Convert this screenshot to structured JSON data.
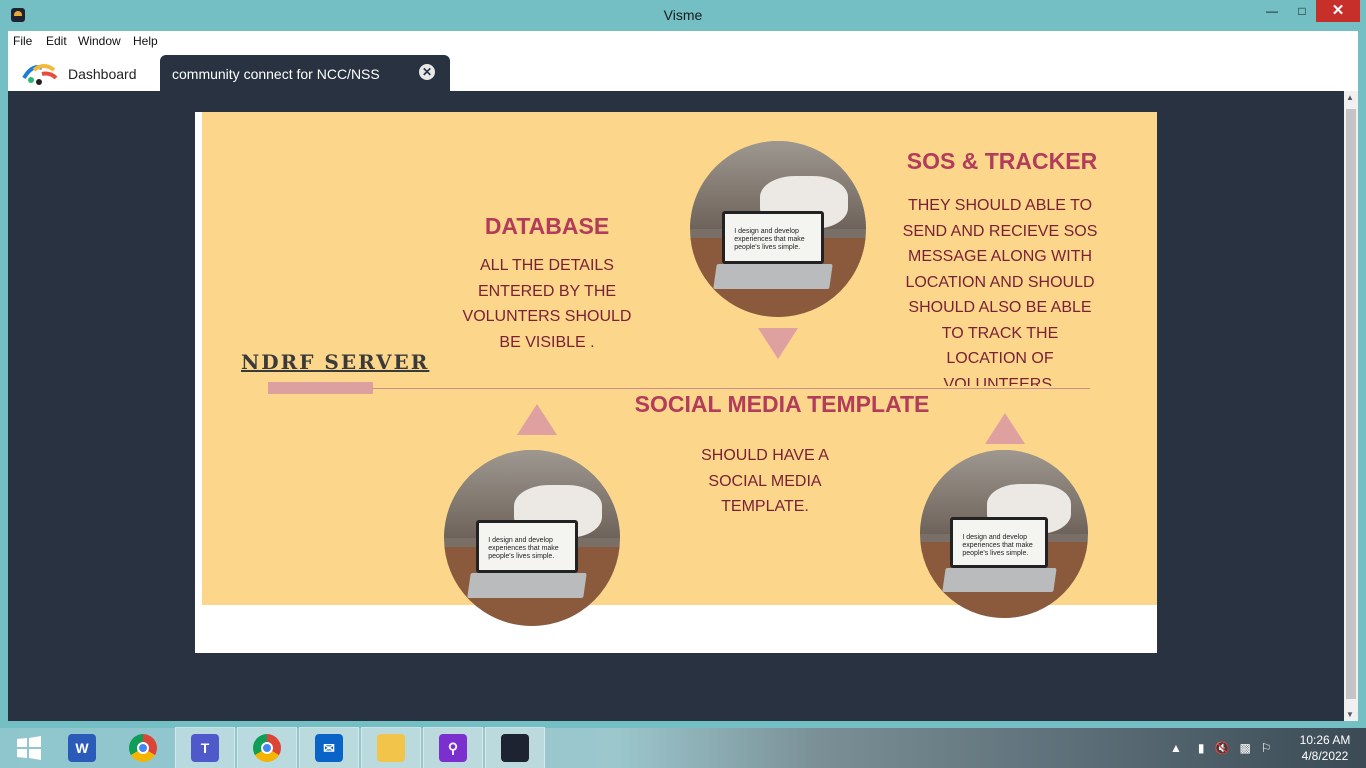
{
  "window": {
    "title": "Visme",
    "min_icon": "minimize-icon",
    "max_icon": "maximize-icon",
    "close_icon": "close-icon"
  },
  "menu": [
    "File",
    "Edit",
    "Window",
    "Help"
  ],
  "tabs": {
    "dashboard": "Dashboard",
    "active": "community connect for NCC/NSS"
  },
  "slide": {
    "database": {
      "title": "DATABASE",
      "text": "ALL THE DETAILS ENTERED BY THE VOLUNTERS SHOULD BE VISIBLE ."
    },
    "sos": {
      "title": "SOS & TRACKER",
      "text": "THEY SHOULD ABLE TO SEND AND RECIEVE SOS MESSAGE ALONG WITH LOCATION AND SHOULD SHOULD ALSO BE ABLE TO TRACK THE LOCATION OF VOLUNTEERS."
    },
    "social": {
      "title": "SOCIAL MEDIA TEMPLATE",
      "text": "SHOULD HAVE A SOCIAL MEDIA TEMPLATE."
    },
    "ndrf": "NDRF SERVER",
    "photo_text": "I design and develop experiences that make people's lives simple."
  },
  "colors": {
    "slide_bg": "#fbd68b",
    "heading": "#b23c5a",
    "text": "#7a1f35",
    "accent": "#dfa0a0",
    "editor_bg": "#283241"
  },
  "taskbar": {
    "apps": [
      "windows-start-icon",
      "word-icon",
      "chrome-icon",
      "teams-icon",
      "chrome-profile-icon",
      "mail-icon",
      "file-explorer-icon",
      "search-app-icon",
      "visme-icon"
    ],
    "time": "10:26 AM",
    "date": "4/8/2022"
  }
}
